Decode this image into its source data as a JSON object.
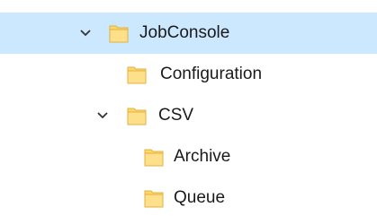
{
  "tree": {
    "items": [
      {
        "label": "JobConsole",
        "expanded": true,
        "selected": true,
        "icon": "folder-icon"
      },
      {
        "label": "Configuration",
        "expanded": false,
        "selected": false,
        "icon": "folder-icon"
      },
      {
        "label": "CSV",
        "expanded": true,
        "selected": false,
        "icon": "folder-icon"
      },
      {
        "label": "Archive",
        "expanded": false,
        "selected": false,
        "icon": "folder-icon"
      },
      {
        "label": "Queue",
        "expanded": false,
        "selected": false,
        "icon": "folder-icon"
      }
    ]
  },
  "colors": {
    "selection": "#cce8ff",
    "folder_fill": "#ffd966",
    "folder_stroke": "#e0b040",
    "chevron": "#333333"
  }
}
